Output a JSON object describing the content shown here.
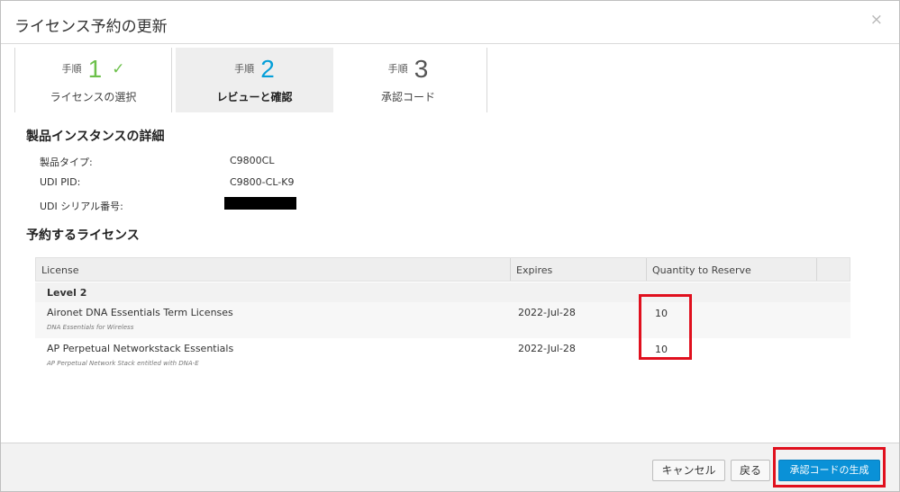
{
  "dialog": {
    "title": "ライセンス予約の更新",
    "close_glyph": "×"
  },
  "steps": [
    {
      "prefix": "手順",
      "number": "1",
      "label": "ライセンスの選択",
      "status": "complete"
    },
    {
      "prefix": "手順",
      "number": "2",
      "label": "レビューと確認",
      "status": "active"
    },
    {
      "prefix": "手順",
      "number": "3",
      "label": "承認コード",
      "status": "pending"
    }
  ],
  "step_check": "✓",
  "instance": {
    "section_title": "製品インスタンスの詳細",
    "fields": [
      {
        "label": "製品タイプ:",
        "value": "C9800CL"
      },
      {
        "label": "UDI PID:",
        "value": "C9800-CL-K9"
      },
      {
        "label": "UDI シリアル番号:",
        "value": ""
      }
    ]
  },
  "licenses": {
    "section_title": "予約するライセンス",
    "columns": [
      "License",
      "Expires",
      "Quantity to Reserve"
    ],
    "group": "Level 2",
    "rows": [
      {
        "name": "Aironet DNA Essentials Term Licenses",
        "description": "DNA Essentials for Wireless",
        "expires": "2022-Jul-28",
        "quantity": "10"
      },
      {
        "name": "AP Perpetual Networkstack Essentials",
        "description": "AP Perpetual Network Stack entitled with DNA-E",
        "expires": "2022-Jul-28",
        "quantity": "10"
      }
    ]
  },
  "footer": {
    "cancel_label": "キャンセル",
    "back_label": "戻る",
    "generate_label": "承認コードの生成"
  },
  "colors": {
    "step_complete": "#6cc04a",
    "step_active": "#049fd9",
    "primary_button": "#0a91d7",
    "highlight": "#e0101e"
  }
}
